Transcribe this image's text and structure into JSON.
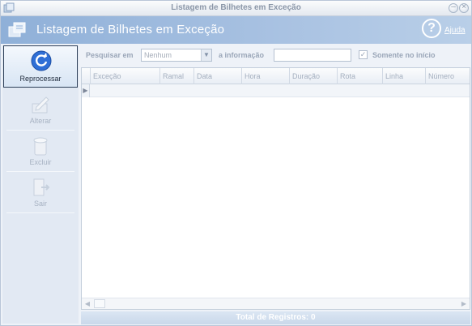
{
  "window": {
    "title": "Listagem de Bilhetes em Exceção"
  },
  "header": {
    "title": "Listagem de Bilhetes em Exceção",
    "help_label": "Ajuda"
  },
  "sidebar": {
    "items": [
      {
        "label": "Reprocessar",
        "icon": "refresh-icon",
        "active": true
      },
      {
        "label": "Alterar",
        "icon": "edit-icon",
        "active": false
      },
      {
        "label": "Excluir",
        "icon": "trash-icon",
        "active": false
      },
      {
        "label": "Sair",
        "icon": "exit-icon",
        "active": false
      }
    ]
  },
  "search": {
    "search_in_label": "Pesquisar em",
    "field_value": "Nenhum",
    "info_label": "a informação",
    "info_value": "",
    "only_start_label": "Somente no início",
    "only_start_checked": true
  },
  "grid": {
    "columns": [
      "Exceção",
      "Ramal",
      "Data",
      "Hora",
      "Duração",
      "Rota",
      "Linha",
      "Número"
    ]
  },
  "footer": {
    "total_label": "Total de Registros: 0"
  },
  "colors": {
    "header_gradient_start": "#8fb0d8",
    "header_gradient_end": "#b9cfe8",
    "sidebar_bg": "#e2e9f3"
  }
}
